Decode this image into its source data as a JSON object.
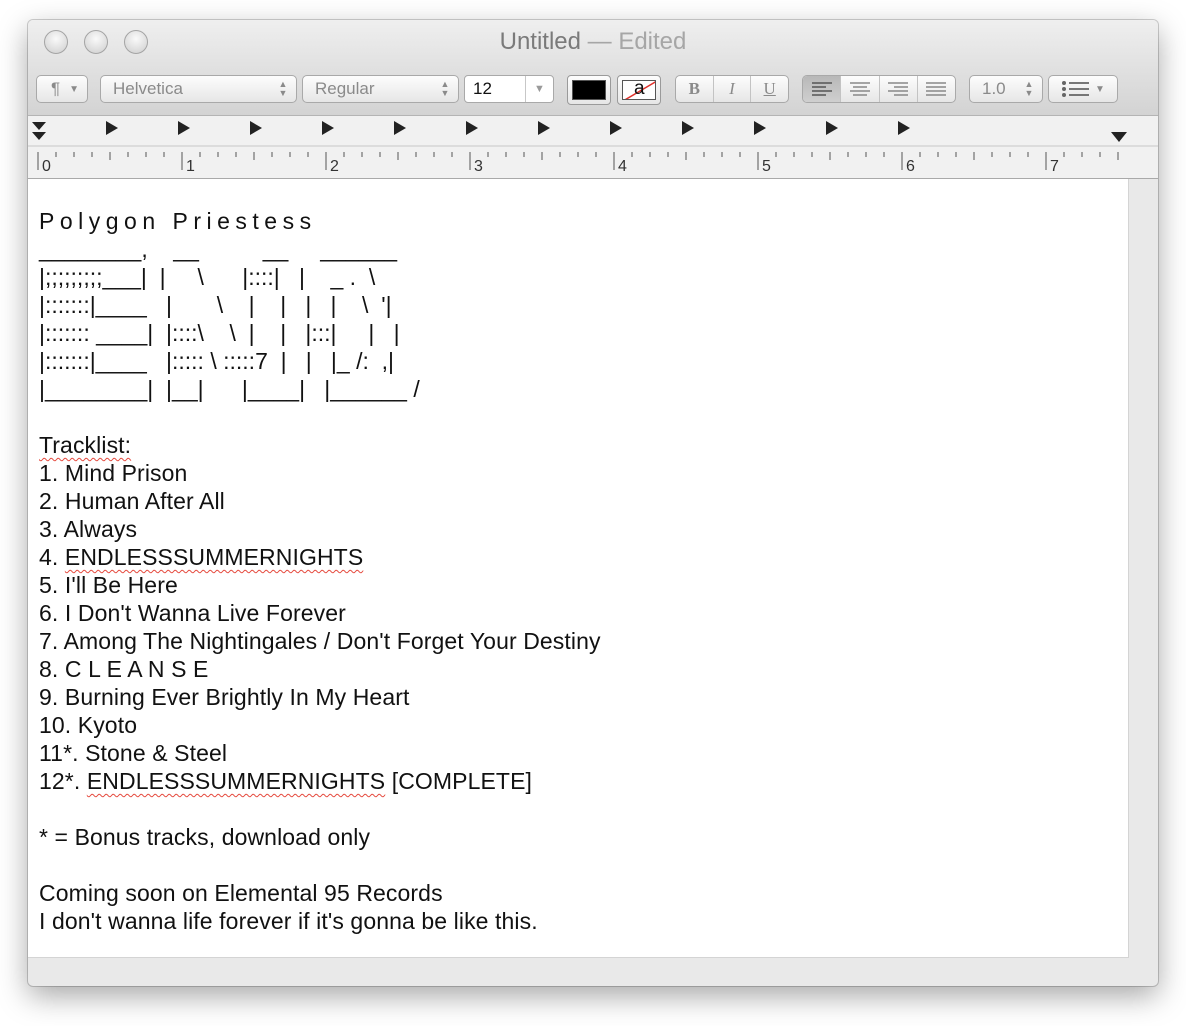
{
  "window": {
    "title": "Untitled",
    "edited_suffix": "— Edited"
  },
  "toolbar": {
    "paragraph_style": "¶",
    "font_family": "Helvetica",
    "font_style": "Regular",
    "font_size": "12",
    "text_color": "#000000",
    "background_label": "a",
    "bold_label": "B",
    "italic_label": "I",
    "underline_label": "U",
    "line_spacing": "1.0"
  },
  "ruler": {
    "numbers": [
      "0",
      "1",
      "2",
      "3",
      "4",
      "5",
      "6",
      "7"
    ]
  },
  "document": {
    "title": "Polygon Priestess",
    "ascii_art": [
      "________,    __          __     ______",
      "|;;;;;;;;;___|  |     \\      |::::|   |    _ .  \\",
      "|:::::::|____   |       \\    |    |   |   |    \\  '|",
      "|::::::: ____|  |::::\\    \\  |    |   |:::|     |   |",
      "|:::::::|____   |::::: \\ :::::7  |   |   |_ /:  ,|",
      "|________|  |__|      |____|   |______ /"
    ],
    "tracklist_label": "Tracklist:",
    "tracks": [
      {
        "prefix": "1. ",
        "title": "Mind Prison",
        "suffix": ""
      },
      {
        "prefix": "2. ",
        "title": "Human After All",
        "suffix": ""
      },
      {
        "prefix": "3. ",
        "title": "Always",
        "suffix": ""
      },
      {
        "prefix": "4. ",
        "title": "ENDLESSSUMMERNIGHTS",
        "suffix": ""
      },
      {
        "prefix": "5. ",
        "title": "I'll Be Here",
        "suffix": ""
      },
      {
        "prefix": "6. ",
        "title": "I Don't Wanna Live Forever",
        "suffix": ""
      },
      {
        "prefix": "7. ",
        "title": "Among The Nightingales / Don't Forget Your Destiny",
        "suffix": ""
      },
      {
        "prefix": "8. ",
        "title": "C L E A N S E",
        "suffix": ""
      },
      {
        "prefix": "9. ",
        "title": "Burning Ever Brightly In My Heart",
        "suffix": ""
      },
      {
        "prefix": "10. ",
        "title": "Kyoto",
        "suffix": ""
      },
      {
        "prefix": "11*. ",
        "title": "Stone & Steel",
        "suffix": ""
      },
      {
        "prefix": "12*. ",
        "title": "ENDLESSSUMMERNIGHTS",
        "suffix": " [COMPLETE]"
      }
    ],
    "bonus_note": "* = Bonus tracks, download only",
    "coming_soon": "Coming soon on Elemental 95 Records",
    "closing_line": "I don't wanna life forever if it's gonna be like this."
  }
}
